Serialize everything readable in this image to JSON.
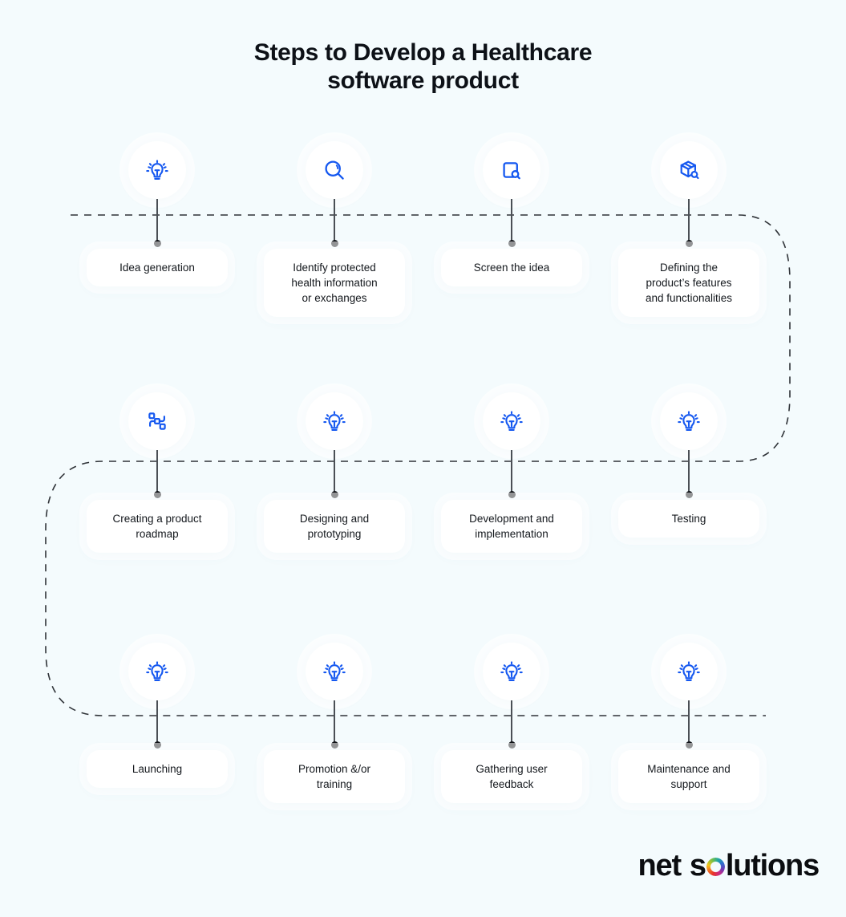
{
  "page": {
    "background_color": "#f4fbfd",
    "accent_color": "#1558f0",
    "text_color": "#10161c"
  },
  "title": {
    "line1": "Steps to Develop a Healthcare",
    "line2": "software product"
  },
  "logo": {
    "word1": "net",
    "word2_before": "s",
    "word2_after": "lutions",
    "ring_icon": "rainbow-ring-icon"
  },
  "rows": [
    {
      "row_index": 1,
      "nodes": [
        {
          "label_lines": [
            "Idea generation"
          ],
          "icon": "lightbulb-icon"
        },
        {
          "label_lines": [
            "Identify protected",
            "health information",
            "or exchanges"
          ],
          "icon": "magnifier-icon"
        },
        {
          "label_lines": [
            "Screen the idea"
          ],
          "icon": "document-search-icon"
        },
        {
          "label_lines": [
            "Defining the",
            "product’s features",
            "and functionalities"
          ],
          "icon": "box-search-icon"
        }
      ]
    },
    {
      "row_index": 2,
      "nodes": [
        {
          "label_lines": [
            "Creating a product",
            "roadmap"
          ],
          "icon": "flowchart-icon"
        },
        {
          "label_lines": [
            "Designing and",
            "prototyping"
          ],
          "icon": "lightbulb-icon"
        },
        {
          "label_lines": [
            "Development and",
            "implementation"
          ],
          "icon": "lightbulb-icon"
        },
        {
          "label_lines": [
            "Testing"
          ],
          "icon": "lightbulb-icon"
        }
      ]
    },
    {
      "row_index": 3,
      "nodes": [
        {
          "label_lines": [
            "Launching"
          ],
          "icon": "lightbulb-icon"
        },
        {
          "label_lines": [
            "Promotion &/or",
            "training"
          ],
          "icon": "lightbulb-icon"
        },
        {
          "label_lines": [
            "Gathering user",
            "feedback"
          ],
          "icon": "lightbulb-icon"
        },
        {
          "label_lines": [
            "Maintenance and",
            "support"
          ],
          "icon": "lightbulb-icon"
        }
      ]
    }
  ]
}
